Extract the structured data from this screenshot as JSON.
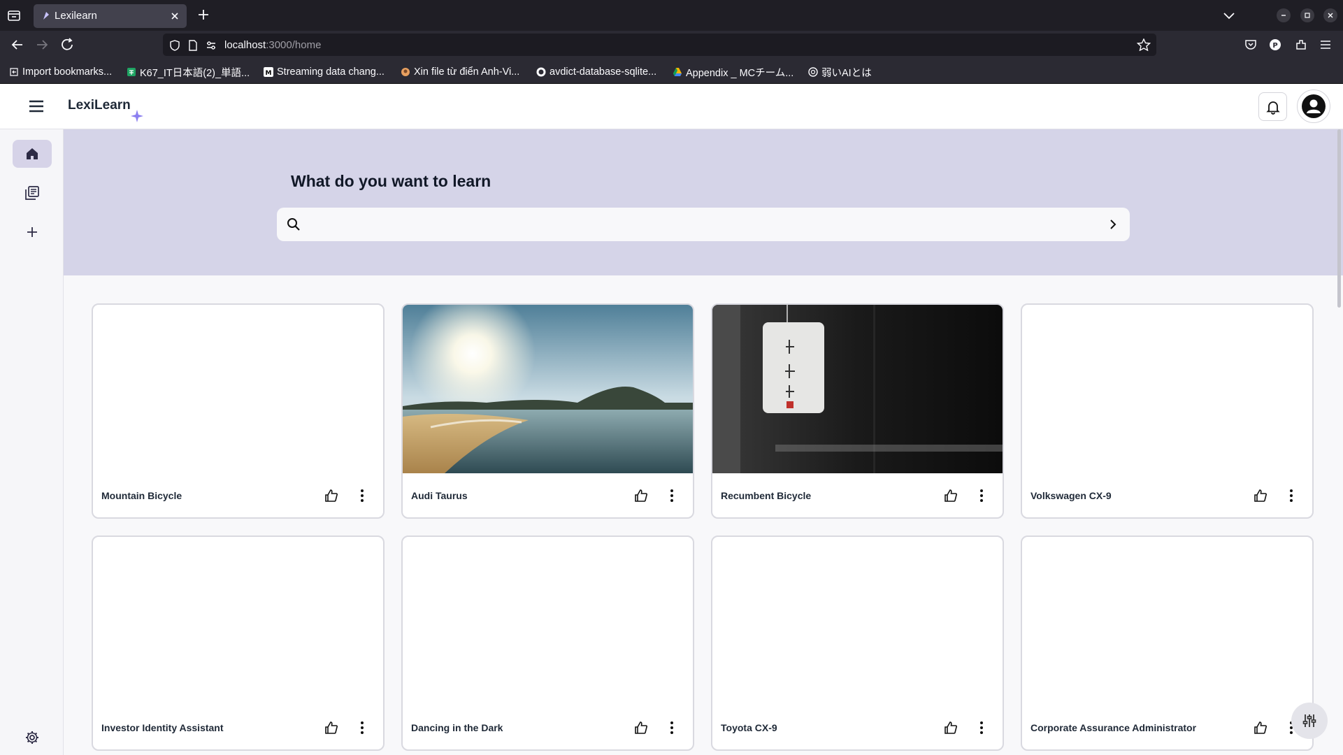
{
  "browser": {
    "tab_title": "Lexilearn",
    "url_host": "localhost",
    "url_path": ":3000/home",
    "bookmarks": [
      {
        "label": "Import bookmarks...",
        "color": "#cfcfd8"
      },
      {
        "label": "K67_IT日本語(2)_単語...",
        "color": "#1fa463"
      },
      {
        "label": "Streaming data chang...",
        "color": "#ffffff"
      },
      {
        "label": "Xin file từ điển Anh-Vi...",
        "color": "#e8a060"
      },
      {
        "label": "avdict-database-sqlite...",
        "color": "#ffffff"
      },
      {
        "label": "Appendix _ MCチーム...",
        "color": "#f4b400"
      },
      {
        "label": "弱いAIとは",
        "color": "#cfcfd8"
      }
    ]
  },
  "app": {
    "logo": "LexiLearn",
    "accent_color": "#8b7ff0",
    "hero_bg": "#d5d4e8",
    "hero_title": "What do you want to learn",
    "search_placeholder": "",
    "sidebar": [
      {
        "name": "home",
        "icon": "home-icon"
      },
      {
        "name": "library",
        "icon": "library-icon"
      },
      {
        "name": "create",
        "icon": "plus-icon"
      },
      {
        "name": "settings",
        "icon": "gear-icon"
      }
    ],
    "cards": [
      {
        "title": "Mountain Bicycle",
        "image": "none"
      },
      {
        "title": "Audi Taurus",
        "image": "beach-sunrise"
      },
      {
        "title": "Recumbent Bicycle",
        "image": "paper-lantern"
      },
      {
        "title": "Volkswagen CX-9",
        "image": "none"
      },
      {
        "title": "Investor Identity Assistant",
        "image": "none"
      },
      {
        "title": "Dancing in the Dark",
        "image": "none"
      },
      {
        "title": "Toyota CX-9",
        "image": "none"
      },
      {
        "title": "Corporate Assurance Administrator",
        "image": "none"
      }
    ]
  }
}
